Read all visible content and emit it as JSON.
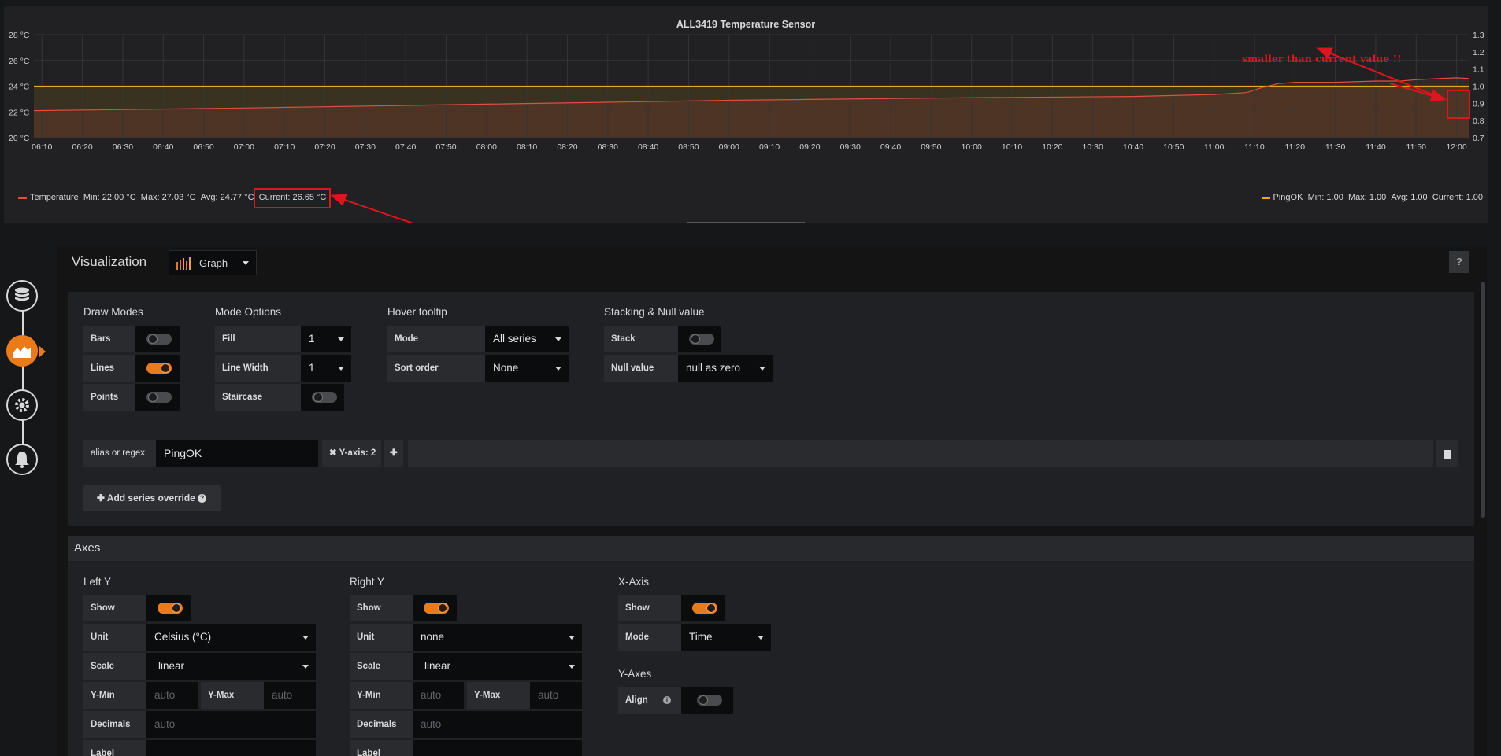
{
  "chart_data": {
    "type": "line",
    "title": "ALL3419 Temperature Sensor",
    "x_ticks": [
      "06:10",
      "06:20",
      "06:30",
      "06:40",
      "06:50",
      "07:00",
      "07:10",
      "07:20",
      "07:30",
      "07:40",
      "07:50",
      "08:00",
      "08:10",
      "08:20",
      "08:30",
      "08:40",
      "08:50",
      "09:00",
      "09:10",
      "09:20",
      "09:30",
      "09:40",
      "09:50",
      "10:00",
      "10:10",
      "10:20",
      "10:30",
      "10:40",
      "10:50",
      "11:00",
      "11:10",
      "11:20",
      "11:30",
      "11:40",
      "11:50",
      "12:00"
    ],
    "y_left_ticks": [
      "28 °C",
      "26 °C",
      "24 °C",
      "22 °C",
      "20 °C"
    ],
    "y_left_range": [
      20,
      28
    ],
    "y_right_ticks": [
      "1.3",
      "1.2",
      "1.1",
      "1.0",
      "0.9",
      "0.8",
      "0.7"
    ],
    "y_right_range": [
      0.7,
      1.3
    ],
    "grid": true,
    "series": [
      {
        "name": "Temperature",
        "axis": "left",
        "color": "#e24d42",
        "x": [
          "06:08",
          "07:00",
          "08:00",
          "09:00",
          "10:00",
          "10:40",
          "11:00",
          "11:08",
          "11:12",
          "11:16",
          "11:20",
          "11:30",
          "11:40",
          "11:46",
          "11:50",
          "11:56",
          "12:00",
          "12:03"
        ],
        "values": [
          22.1,
          22.3,
          22.6,
          22.9,
          23.1,
          23.2,
          23.35,
          23.5,
          23.9,
          24.2,
          24.3,
          24.3,
          24.4,
          24.4,
          24.5,
          24.6,
          24.65,
          24.6
        ],
        "legend": {
          "min": "Min: 22.00 °C",
          "max": "Max: 27.03 °C",
          "avg": "Avg: 24.77 °C",
          "current": "Current: 26.65 °C"
        }
      },
      {
        "name": "PingOK",
        "axis": "right",
        "color": "#e5ac0e",
        "x": [
          "06:08",
          "12:03"
        ],
        "values": [
          1.0,
          1.0
        ],
        "legend": {
          "min": "Min: 1.00",
          "max": "Max: 1.00",
          "avg": "Avg: 1.00",
          "current": "Current: 1.00"
        }
      }
    ],
    "annotation": "smaller than current value !!"
  },
  "sidebar": {
    "items": [
      {
        "icon": "database-icon"
      },
      {
        "icon": "chart-icon",
        "active": true
      },
      {
        "icon": "gear-icon"
      },
      {
        "icon": "bell-icon"
      }
    ]
  },
  "editor": {
    "visualization_label": "Visualization",
    "visualization_value": "Graph",
    "help_label": "?",
    "draw_modes": {
      "title": "Draw Modes",
      "bars": {
        "label": "Bars",
        "on": false
      },
      "lines": {
        "label": "Lines",
        "on": true
      },
      "points": {
        "label": "Points",
        "on": false
      }
    },
    "mode_options": {
      "title": "Mode Options",
      "fill_label": "Fill",
      "fill_value": "1",
      "line_width_label": "Line Width",
      "line_width_value": "1",
      "staircase_label": "Staircase",
      "staircase_on": false
    },
    "hover_tooltip": {
      "title": "Hover tooltip",
      "mode_label": "Mode",
      "mode_value": "All series",
      "sort_label": "Sort order",
      "sort_value": "None"
    },
    "stacking": {
      "title": "Stacking & Null value",
      "stack_label": "Stack",
      "stack_on": false,
      "null_label": "Null value",
      "null_value": "null as zero"
    },
    "override": {
      "alias_label": "alias or regex",
      "alias_value": "PingOK",
      "yaxis_tag": "✖ Y-axis: 2",
      "add_label": "✚ Add series override"
    },
    "axes": {
      "title": "Axes",
      "left_y": {
        "title": "Left Y",
        "show_label": "Show",
        "show_on": true,
        "unit_label": "Unit",
        "unit_value": "Celsius (°C)",
        "scale_label": "Scale",
        "scale_value": "linear",
        "ymin_label": "Y-Min",
        "ymin_placeholder": "auto",
        "ymax_label": "Y-Max",
        "ymax_placeholder": "auto",
        "decimals_label": "Decimals",
        "decimals_placeholder": "auto",
        "label_label": "Label"
      },
      "right_y": {
        "title": "Right Y",
        "show_label": "Show",
        "show_on": true,
        "unit_label": "Unit",
        "unit_value": "none",
        "scale_label": "Scale",
        "scale_value": "linear",
        "ymin_label": "Y-Min",
        "ymin_placeholder": "auto",
        "ymax_label": "Y-Max",
        "ymax_placeholder": "auto",
        "decimals_label": "Decimals",
        "decimals_placeholder": "auto",
        "label_label": "Label"
      },
      "x_axis": {
        "title": "X-Axis",
        "show_label": "Show",
        "show_on": true,
        "mode_label": "Mode",
        "mode_value": "Time"
      },
      "y_axes": {
        "title": "Y-Axes",
        "align_label": "Align",
        "align_on": false
      }
    }
  },
  "colors": {
    "accent": "#eb7b18",
    "annotation": "#e0141c",
    "threshold": "#e5ac0e"
  }
}
